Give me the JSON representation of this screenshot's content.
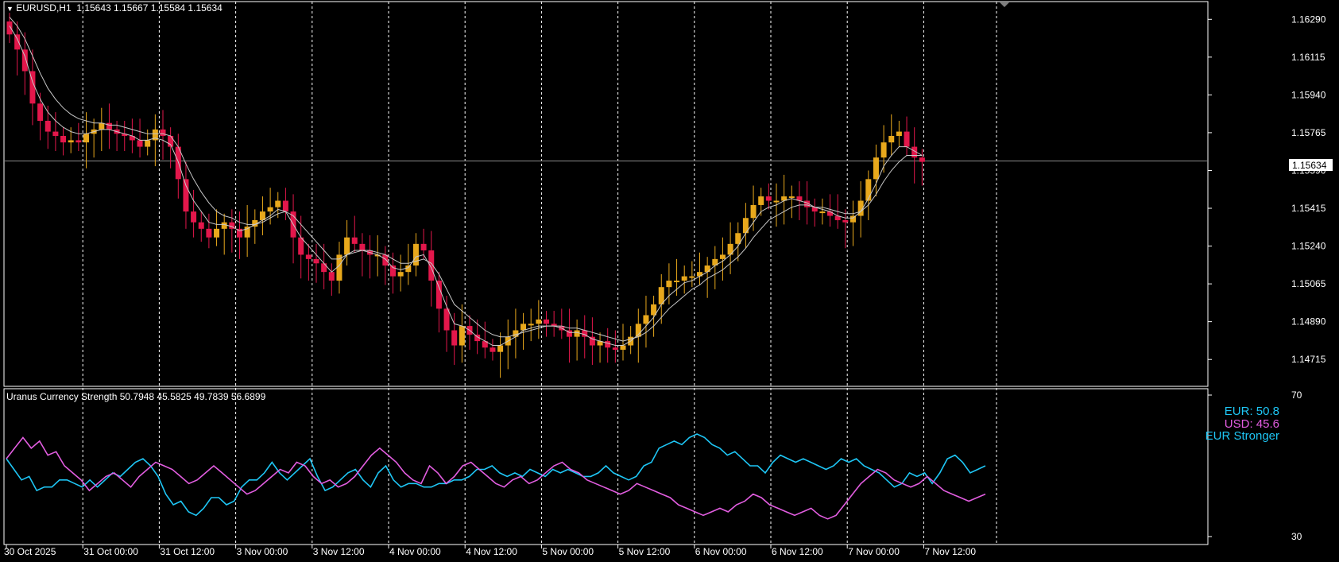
{
  "header": {
    "symbol": "EURUSD,H1",
    "ohlc": "1.15643 1.15667 1.15584 1.15634"
  },
  "indicator": {
    "title": "Uranus Currency Strength 50.7948 45.5825 49.7839 56.6899",
    "eur_label": "EUR: 50.8",
    "usd_label": "USD: 45.6",
    "verdict": "EUR Stronger"
  },
  "colors": {
    "bull": "#e8a81c",
    "bear": "#e3174b",
    "eur": "#1ec6f5",
    "usd": "#e25de0",
    "ma": "#c8c8c8",
    "frame": "#ffffff"
  },
  "chart_data": [
    {
      "type": "candlestick",
      "price_ticks": [
        "1.16290",
        "1.16115",
        "1.15940",
        "1.15765",
        "1.15590",
        "1.15415",
        "1.15240",
        "1.15065",
        "1.14890",
        "1.14715"
      ],
      "current_price": "1.15634",
      "ylim": [
        1.1462,
        1.1635
      ],
      "time_labels": [
        "30 Oct 2025",
        "31 Oct 00:00",
        "31 Oct 12:00",
        "3 Nov 00:00",
        "3 Nov 12:00",
        "4 Nov 00:00",
        "4 Nov 12:00",
        "5 Nov 00:00",
        "5 Nov 12:00",
        "6 Nov 00:00",
        "6 Nov 12:00",
        "7 Nov 00:00",
        "7 Nov 12:00"
      ],
      "closes": [
        1.1622,
        1.1615,
        1.1605,
        1.159,
        1.1582,
        1.1577,
        1.1575,
        1.1572,
        1.1573,
        1.1572,
        1.1576,
        1.1578,
        1.1581,
        1.1578,
        1.1576,
        1.1575,
        1.1573,
        1.157,
        1.1573,
        1.1578,
        1.1575,
        1.157,
        1.1555,
        1.154,
        1.1535,
        1.1532,
        1.1528,
        1.1532,
        1.1535,
        1.1532,
        1.1528,
        1.1533,
        1.1536,
        1.154,
        1.1542,
        1.1545,
        1.154,
        1.1528,
        1.152,
        1.1518,
        1.1516,
        1.1512,
        1.1508,
        1.152,
        1.1528,
        1.1525,
        1.1522,
        1.152,
        1.152,
        1.1515,
        1.151,
        1.1512,
        1.1515,
        1.1525,
        1.1522,
        1.1508,
        1.1495,
        1.1485,
        1.1478,
        1.1487,
        1.1483,
        1.148,
        1.1477,
        1.1475,
        1.1478,
        1.1482,
        1.1485,
        1.1488,
        1.1488,
        1.149,
        1.1488,
        1.1487,
        1.1485,
        1.1482,
        1.1485,
        1.1482,
        1.1478,
        1.148,
        1.1477,
        1.1476,
        1.1478,
        1.1482,
        1.1488,
        1.1492,
        1.1497,
        1.1505,
        1.1508,
        1.1508,
        1.151,
        1.151,
        1.1512,
        1.1515,
        1.1518,
        1.152,
        1.1525,
        1.153,
        1.1537,
        1.1543,
        1.1547,
        1.1545,
        1.1545,
        1.1547,
        1.1547,
        1.1545,
        1.1542,
        1.154,
        1.154,
        1.1538,
        1.1536,
        1.1535,
        1.1538,
        1.1545,
        1.1555,
        1.1565,
        1.1572,
        1.1575,
        1.1577,
        1.157,
        1.1565,
        1.1563
      ],
      "ma_fast": [
        1.1626,
        1.162,
        1.1612,
        1.16,
        1.1592,
        1.1586,
        1.1582,
        1.1579,
        1.1577,
        1.1576,
        1.1576,
        1.1577,
        1.1578,
        1.1578,
        1.1577,
        1.1576,
        1.1575,
        1.1573,
        1.1573,
        1.1574,
        1.1573,
        1.1571,
        1.1563,
        1.1552,
        1.1545,
        1.154,
        1.1535,
        1.1534,
        1.1534,
        1.1533,
        1.1531,
        1.1532,
        1.1534,
        1.1536,
        1.1538,
        1.1541,
        1.154,
        1.1534,
        1.1528,
        1.1524,
        1.152,
        1.1516,
        1.1512,
        1.1515,
        1.152,
        1.1522,
        1.1522,
        1.1521,
        1.152,
        1.1518,
        1.1514,
        1.1513,
        1.1514,
        1.1519,
        1.152,
        1.1514,
        1.1505,
        1.1496,
        1.1488,
        1.1487,
        1.1485,
        1.1482,
        1.148,
        1.1478,
        1.1478,
        1.148,
        1.1482,
        1.1485,
        1.1486,
        1.1487,
        1.1487,
        1.1487,
        1.1486,
        1.1484,
        1.1484,
        1.1483,
        1.1481,
        1.148,
        1.1479,
        1.1478,
        1.1478,
        1.148,
        1.1483,
        1.1487,
        1.1491,
        1.1497,
        1.1501,
        1.1504,
        1.1507,
        1.1508,
        1.151,
        1.1512,
        1.1515,
        1.1517,
        1.152,
        1.1524,
        1.153,
        1.1535,
        1.154,
        1.1542,
        1.1543,
        1.1545,
        1.1546,
        1.1545,
        1.1544,
        1.1542,
        1.1541,
        1.154,
        1.1538,
        1.1537,
        1.1537,
        1.154,
        1.1546,
        1.1553,
        1.1561,
        1.1566,
        1.157,
        1.157,
        1.1568,
        1.1566
      ],
      "ma_slow": [
        1.163,
        1.1626,
        1.162,
        1.1612,
        1.1604,
        1.1597,
        1.1592,
        1.1588,
        1.1585,
        1.1583,
        1.1582,
        1.1581,
        1.1581,
        1.158,
        1.158,
        1.1579,
        1.1578,
        1.1577,
        1.1576,
        1.1576,
        1.1576,
        1.1575,
        1.157,
        1.1562,
        1.1555,
        1.1549,
        1.1544,
        1.154,
        1.1538,
        1.1537,
        1.1535,
        1.1534,
        1.1534,
        1.1535,
        1.1537,
        1.1539,
        1.154,
        1.1538,
        1.1534,
        1.153,
        1.1526,
        1.1522,
        1.1518,
        1.1518,
        1.152,
        1.1521,
        1.1522,
        1.1522,
        1.1521,
        1.152,
        1.1518,
        1.1516,
        1.1516,
        1.1517,
        1.1518,
        1.1516,
        1.1511,
        1.1504,
        1.1497,
        1.1494,
        1.1491,
        1.1488,
        1.1485,
        1.1483,
        1.1482,
        1.1482,
        1.1483,
        1.1484,
        1.1485,
        1.1486,
        1.1487,
        1.1487,
        1.1487,
        1.1486,
        1.1486,
        1.1485,
        1.1484,
        1.1483,
        1.1482,
        1.1481,
        1.148,
        1.1481,
        1.1482,
        1.1484,
        1.1487,
        1.1491,
        1.1495,
        1.1498,
        1.1501,
        1.1504,
        1.1506,
        1.1509,
        1.1511,
        1.1513,
        1.1516,
        1.1519,
        1.1523,
        1.1528,
        1.1532,
        1.1536,
        1.1538,
        1.154,
        1.1542,
        1.1543,
        1.1543,
        1.1542,
        1.1542,
        1.1541,
        1.154,
        1.1539,
        1.1539,
        1.154,
        1.1543,
        1.1548,
        1.1554,
        1.1559,
        1.1563,
        1.1566,
        1.1566,
        1.1566
      ]
    },
    {
      "type": "line",
      "ylim": [
        30,
        70
      ],
      "y_ticks": [
        "70",
        "30"
      ],
      "series": [
        {
          "name": "EUR",
          "values": [
            52,
            49,
            46,
            47,
            43,
            44,
            44,
            46,
            46,
            45,
            44,
            46,
            44,
            46,
            48,
            47,
            49,
            51,
            52,
            50,
            47,
            42,
            39,
            40,
            37,
            36,
            38,
            41,
            41,
            39,
            40,
            44,
            46,
            46,
            48,
            51,
            48,
            46,
            48,
            50,
            52,
            47,
            43,
            44,
            46,
            48,
            49,
            46,
            44,
            48,
            50,
            46,
            44,
            45,
            45,
            44,
            44,
            45,
            45,
            46,
            46,
            47,
            49,
            49,
            50,
            48,
            47,
            48,
            47,
            49,
            48,
            47,
            49,
            48,
            49,
            48,
            47,
            47,
            48,
            50,
            48,
            47,
            46,
            47,
            50,
            51,
            55,
            56,
            57,
            56,
            58,
            59,
            58,
            56,
            55,
            53,
            54,
            52,
            50,
            50,
            48,
            51,
            53,
            52,
            51,
            52,
            51,
            50,
            49,
            50,
            52,
            51,
            52,
            50,
            49,
            48,
            46,
            44,
            45,
            48,
            47,
            48,
            45,
            48,
            52,
            53,
            51,
            48,
            49,
            50
          ]
        },
        {
          "name": "USD",
          "values": [
            52,
            55,
            58,
            55,
            57,
            53,
            54,
            50,
            48,
            46,
            43,
            45,
            47,
            48,
            46,
            44,
            47,
            49,
            51,
            50,
            49,
            47,
            45,
            46,
            48,
            50,
            48,
            46,
            44,
            42,
            43,
            45,
            47,
            49,
            48,
            51,
            50,
            47,
            45,
            46,
            44,
            45,
            47,
            50,
            53,
            55,
            53,
            51,
            48,
            46,
            45,
            50,
            48,
            45,
            47,
            50,
            51,
            49,
            47,
            45,
            44,
            46,
            47,
            45,
            46,
            48,
            50,
            51,
            49,
            48,
            46,
            45,
            44,
            43,
            42,
            43,
            45,
            44,
            43,
            42,
            41,
            39,
            38,
            37,
            36,
            37,
            38,
            37,
            39,
            40,
            42,
            41,
            39,
            38,
            37,
            36,
            37,
            38,
            36,
            35,
            36,
            39,
            42,
            45,
            47,
            49,
            48,
            46,
            45,
            44,
            45,
            47,
            45,
            43,
            42,
            41,
            40,
            41,
            42
          ]
        }
      ]
    }
  ]
}
